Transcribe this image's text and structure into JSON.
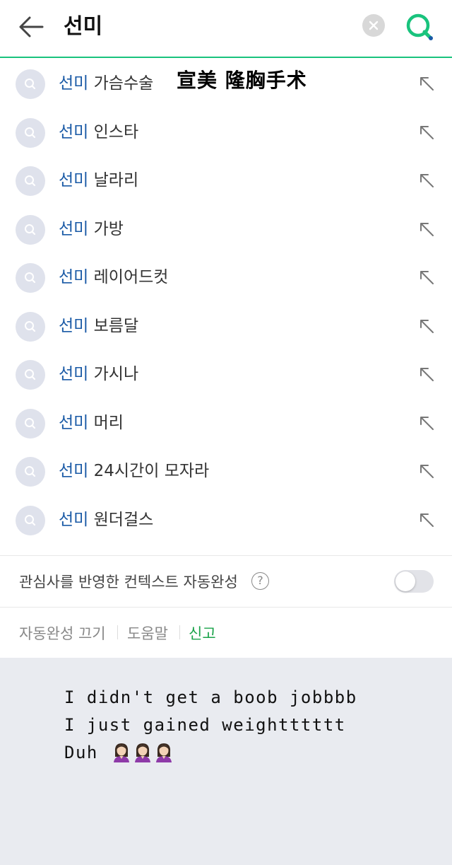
{
  "search": {
    "query": "선미"
  },
  "overlay_caption": "宣美 隆胸手术",
  "suggestions": [
    {
      "key": "선미",
      "rest": " 가슴수술"
    },
    {
      "key": "선미",
      "rest": " 인스타"
    },
    {
      "key": "선미",
      "rest": " 날라리"
    },
    {
      "key": "선미",
      "rest": " 가방"
    },
    {
      "key": "선미",
      "rest": " 레이어드컷"
    },
    {
      "key": "선미",
      "rest": " 보름달"
    },
    {
      "key": "선미",
      "rest": " 가시나"
    },
    {
      "key": "선미",
      "rest": " 머리"
    },
    {
      "key": "선미",
      "rest": " 24시간이 모자라"
    },
    {
      "key": "선미",
      "rest": " 원더걸스"
    }
  ],
  "context_autocomplete": {
    "label": "관심사를 반영한 컨텍스트 자동완성",
    "help": "?",
    "enabled": false
  },
  "footer": {
    "autocomplete_off": "자동완성 끄기",
    "help": "도움말",
    "report": "신고"
  },
  "story": {
    "line1": "I didn't get a boob jobbbb",
    "line2": "I just gained weightttttt",
    "line3": "Duh"
  },
  "colors": {
    "accent_green": "#19c37d",
    "keyword_blue": "#1a5aa6",
    "report_green": "#1aa34a",
    "story_bg": "#e9ebf0"
  },
  "icons": [
    "back-arrow-icon",
    "clear-icon",
    "search-icon",
    "suggestion-search-icon",
    "insert-arrow-icon",
    "help-icon",
    "woman-emoji-icon"
  ]
}
